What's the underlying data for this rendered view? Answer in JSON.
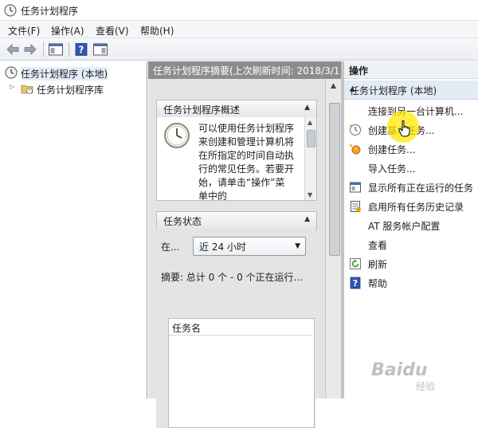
{
  "window": {
    "title": "任务计划程序",
    "icon": "clock-icon"
  },
  "menu": [
    {
      "label": "文件(F)"
    },
    {
      "label": "操作(A)"
    },
    {
      "label": "查看(V)"
    },
    {
      "label": "帮助(H)"
    }
  ],
  "toolbar": {
    "buttons": [
      "back-arrow-icon",
      "forward-arrow-icon",
      "show-hide-console-tree-icon",
      "help-icon",
      "show-hide-action-pane-icon"
    ]
  },
  "tree": {
    "root_label": "任务计划程序 (本地)",
    "child_label": "任务计划程序库"
  },
  "middle": {
    "header": "任务计划程序摘要(上次刷新时间: 2018/3/1",
    "overview": {
      "title": "任务计划程序概述",
      "text": "可以使用任务计划程序来创建和管理计算机将在所指定的时间自动执行的常见任务。若要开始，请单击“操作”菜单中的"
    },
    "status": {
      "title": "任务状态",
      "range_label": "在...",
      "range_value": "近 24 小时",
      "summary": "摘要: 总计 0 个 - 0 个正在运行...",
      "table_header": "任务名"
    }
  },
  "actions": {
    "header": "操作",
    "group": "任务计划程序 (本地)",
    "items": [
      {
        "label": "连接到另一台计算机...",
        "icon": ""
      },
      {
        "label": "创建基本任务...",
        "icon": "create-basic-task-icon"
      },
      {
        "label": "创建任务...",
        "icon": "create-task-icon"
      },
      {
        "label": "导入任务...",
        "icon": ""
      },
      {
        "label": "显示所有正在运行的任务",
        "icon": "running-tasks-icon"
      },
      {
        "label": "启用所有任务历史记录",
        "icon": "task-history-icon"
      },
      {
        "label": "AT 服务帐户配置",
        "icon": ""
      },
      {
        "label": "查看",
        "icon": ""
      },
      {
        "label": "刷新",
        "icon": "refresh-icon"
      },
      {
        "label": "帮助",
        "icon": "help-icon"
      }
    ]
  },
  "watermark": {
    "main": "Baidu",
    "sub": "经验"
  }
}
